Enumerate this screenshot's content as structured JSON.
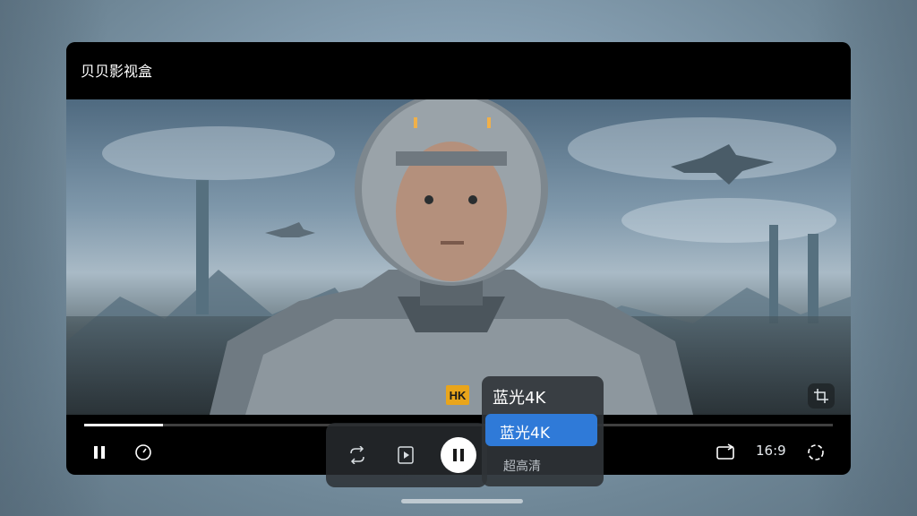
{
  "app": {
    "title": "贝贝影视盒"
  },
  "overlay": {
    "badge": "HK"
  },
  "controls": {
    "aspect_ratio": "16:9"
  },
  "quality_menu": {
    "current": "蓝光4K",
    "options": [
      {
        "label": "蓝光4K",
        "selected": true
      },
      {
        "label": "超高清",
        "selected": false
      }
    ]
  },
  "playback": {
    "progress": 0.105,
    "state": "playing"
  },
  "icons": {
    "pause": "pause-icon",
    "speed": "speed-icon",
    "loop": "loop-icon",
    "next": "next-episode-icon",
    "cast": "cast-icon",
    "fullscreen": "fullscreen-icon",
    "crop": "crop-icon"
  },
  "colors": {
    "accent": "#2f7ad8",
    "badge": "#e9a51b"
  }
}
